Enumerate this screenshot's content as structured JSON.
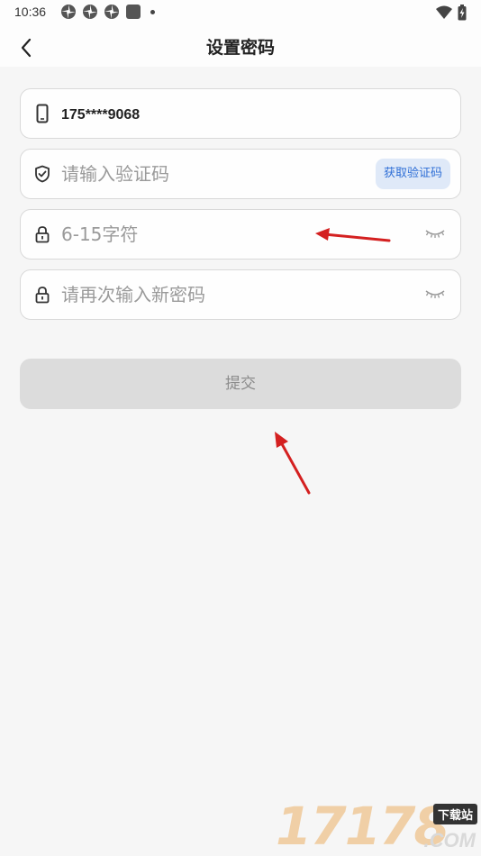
{
  "status_bar": {
    "time": "10:36",
    "notification_icons": [
      "pinwheel-icon",
      "pinwheel-icon",
      "pinwheel-icon",
      "square-app-icon"
    ],
    "right_icons": [
      "wifi-icon",
      "battery-charging-icon"
    ]
  },
  "header": {
    "title": "设置密码",
    "back_icon": "chevron-left-icon"
  },
  "form": {
    "phone": {
      "value": "175****9068",
      "icon": "phone-icon"
    },
    "code": {
      "placeholder": "请输入验证码",
      "icon": "shield-icon",
      "button_label": "获取验证码"
    },
    "password": {
      "placeholder": "6-15字符",
      "icon": "lock-icon",
      "toggle_icon": "eye-closed-icon"
    },
    "confirm_password": {
      "placeholder": "请再次输入新密码",
      "icon": "lock-icon",
      "toggle_icon": "eye-closed-icon"
    },
    "submit_label": "提交"
  },
  "annotations": {
    "arrow_color": "#d42020"
  },
  "watermark": {
    "digits": "17178",
    "badge": "下载站",
    "domain": ".COM"
  },
  "colors": {
    "accent": "#2f6fd6",
    "accent_bg": "#dfe9f8",
    "disabled_button": "#dcdcdc"
  }
}
